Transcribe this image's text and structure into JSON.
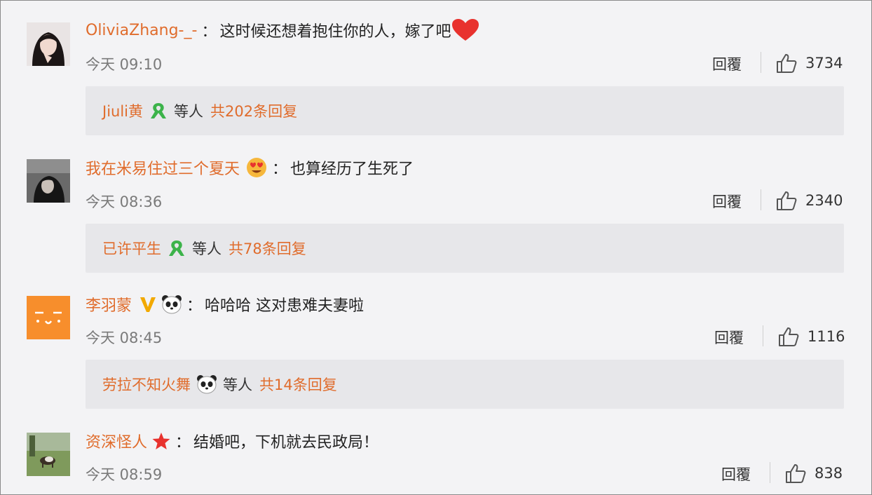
{
  "comments": [
    {
      "user": "OliviaZhang-_-",
      "badges": [],
      "colon": "：",
      "text": "这时候还想着抱住你的人，嫁了吧",
      "trailing_icon": "heart-icon",
      "time": "今天 09:10",
      "reply_label": "回覆",
      "likes": "3734",
      "reply_preview": {
        "name": "Jiuli黄",
        "badge": "ribbon-icon",
        "suffix": "等人",
        "total": "共202条回复"
      }
    },
    {
      "user": "我在米易住过三个夏天",
      "badges": [
        "heart-eyes-emoji-icon"
      ],
      "colon": "：",
      "text": "也算经历了生死了",
      "trailing_icon": "",
      "time": "今天 08:36",
      "reply_label": "回覆",
      "likes": "2340",
      "reply_preview": {
        "name": "已许平生",
        "badge": "ribbon-icon",
        "suffix": "等人",
        "total": "共78条回复"
      }
    },
    {
      "user": "李羽蒙",
      "badges": [
        "verified-v-icon",
        "panda-icon"
      ],
      "colon": "：",
      "text": "哈哈哈 这对患难夫妻啦",
      "trailing_icon": "",
      "time": "今天 08:45",
      "reply_label": "回覆",
      "likes": "1116",
      "reply_preview": {
        "name": "劳拉不知火舞",
        "badge": "panda-icon",
        "suffix": "等人",
        "total": "共14条回复"
      }
    },
    {
      "user": "资深怪人",
      "badges": [
        "red-star-icon"
      ],
      "colon": "：",
      "text": "结婚吧，下机就去民政局！",
      "trailing_icon": "",
      "time": "今天 08:59",
      "reply_label": "回覆",
      "likes": "838",
      "reply_preview": null
    }
  ],
  "colors": {
    "username": "#e06c2c",
    "reply_box": "#e7e7ea",
    "heart": "#e8322e",
    "ribbon": "#3cb34a",
    "star": "#e8322e",
    "v": "#f2a900"
  }
}
